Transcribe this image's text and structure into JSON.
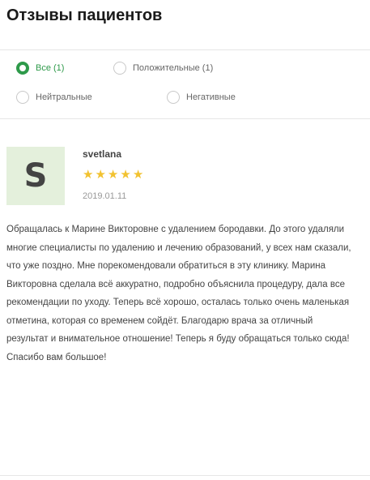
{
  "header": {
    "title": "Отзывы пациентов"
  },
  "filters": [
    {
      "label": "Все (1)",
      "selected": true
    },
    {
      "label": "Положительные (1)",
      "selected": false
    },
    {
      "label": "Нейтральные",
      "selected": false
    },
    {
      "label": "Негативные",
      "selected": false
    }
  ],
  "review": {
    "avatar_letter": "S",
    "author": "svetlana",
    "rating": 5,
    "date": "2019.01.11",
    "text": "Обращалась к Марине Викторовне с удалением бородавки. До этого удаляли многие специалисты по удалению и лечению образований, у всех нам сказали, что уже поздно. Мне порекомендовали обратиться в эту клинику. Марина Викторовна сделала всё аккуратно, подробно объяснила процедуру, дала все рекомендации по уходу. Теперь всё хорошо, осталась только очень маленькая отметина, которая со временем сойдёт. Благодарю врача за отличный результат и внимательное отношение! Теперь я буду обращаться только сюда! Спасибо вам большое!"
  }
}
